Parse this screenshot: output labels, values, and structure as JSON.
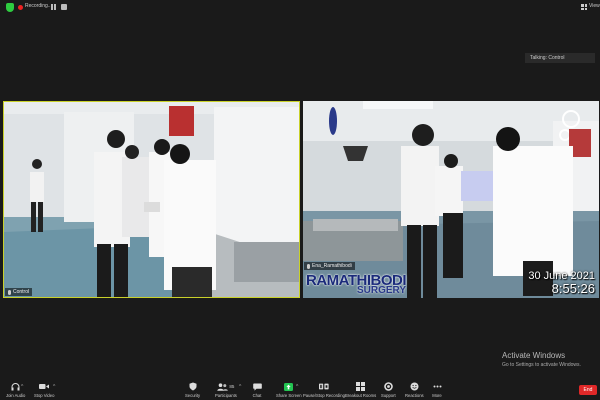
{
  "topbar": {
    "recording_label": "Recording...",
    "view_label": "View"
  },
  "talking": {
    "text": "Talking: Control"
  },
  "tiles": {
    "left": {
      "name": "Control"
    },
    "right": {
      "name": "Ena_Ramathibodi",
      "logo_line1": "RAMATHIBODI",
      "logo_line2": "SURGERY",
      "date": "30 June 2021",
      "time": "8:55:26"
    }
  },
  "activate": {
    "title": "Activate Windows",
    "subtitle": "Go to Settings to activate Windows."
  },
  "toolbar": {
    "join_audio": "Join Audio",
    "stop_video": "Stop Video",
    "security": "Security",
    "participants": "Participants",
    "participants_count": "85",
    "chat": "Chat",
    "share_screen": "Share Screen",
    "pause_stop_recording": "Pause/Stop Recording",
    "breakout_rooms": "Breakout Rooms",
    "support": "Support",
    "reactions": "Reactions",
    "more": "More",
    "end": "End"
  },
  "colors": {
    "active_border": "#c9d12a",
    "share_green": "#23c552",
    "end_red": "#e02828",
    "logo_blue": "#1a2a7a"
  }
}
